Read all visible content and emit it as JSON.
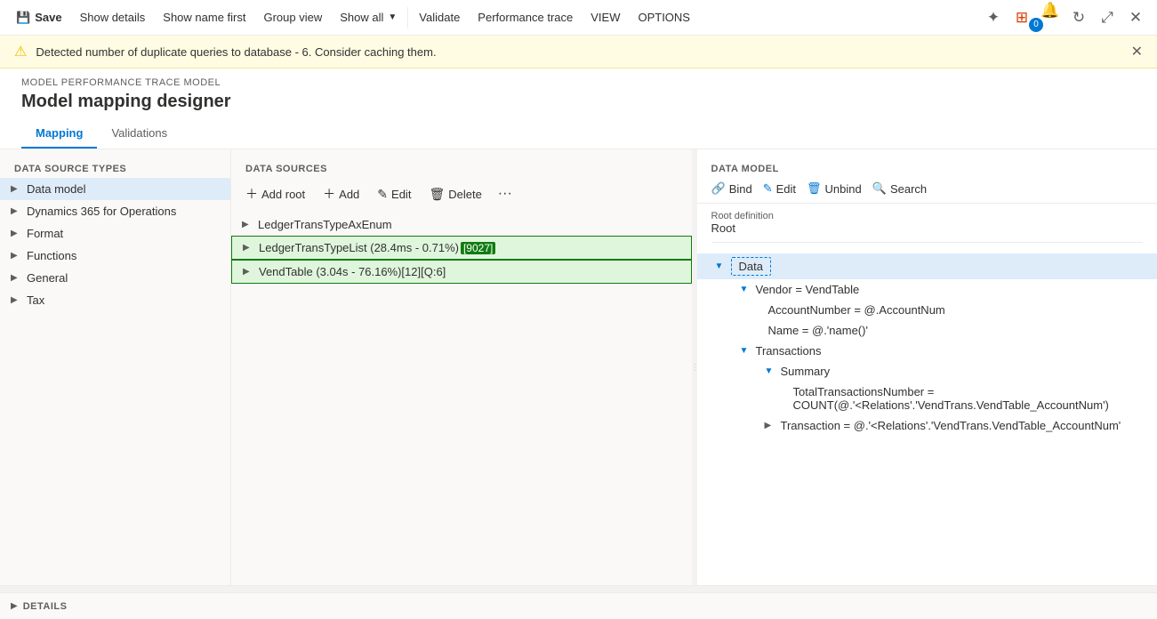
{
  "toolbar": {
    "save_label": "Save",
    "show_details_label": "Show details",
    "show_name_first_label": "Show name first",
    "group_view_label": "Group view",
    "show_all_label": "Show all",
    "validate_label": "Validate",
    "performance_trace_label": "Performance trace",
    "view_label": "VIEW",
    "options_label": "OPTIONS"
  },
  "warning": {
    "message": "Detected number of duplicate queries to database - 6. Consider caching them."
  },
  "breadcrumb": "MODEL PERFORMANCE TRACE MODEL",
  "page_title": "Model mapping designer",
  "tabs": [
    {
      "label": "Mapping",
      "active": true
    },
    {
      "label": "Validations",
      "active": false
    }
  ],
  "left_panel": {
    "data_source_types_header": "DATA SOURCE TYPES",
    "types": [
      {
        "label": "Data model",
        "selected": true
      },
      {
        "label": "Dynamics 365 for Operations"
      },
      {
        "label": "Format"
      },
      {
        "label": "Functions"
      },
      {
        "label": "General"
      },
      {
        "label": "Tax"
      }
    ]
  },
  "data_sources": {
    "header": "DATA SOURCES",
    "add_root_label": "Add root",
    "add_label": "Add",
    "edit_label": "Edit",
    "delete_label": "Delete",
    "items": [
      {
        "label": "LedgerTransTypeAxEnum",
        "highlighted": false
      },
      {
        "label": "LedgerTransTypeList (28.4ms - 0.71%)",
        "badge": "[9027]",
        "highlighted": true
      },
      {
        "label": "VendTable (3.04s - 76.16%)[12][Q:6]",
        "highlighted": true,
        "selected": true
      }
    ]
  },
  "data_model": {
    "header": "DATA MODEL",
    "bind_label": "Bind",
    "edit_label": "Edit",
    "unbind_label": "Unbind",
    "search_label": "Search",
    "root_definition_label": "Root definition",
    "root_value": "Root",
    "tree": [
      {
        "label": "Data",
        "level": 0,
        "expanded": true,
        "selected": true,
        "children": [
          {
            "label": "Vendor = VendTable",
            "level": 1,
            "expanded": true,
            "children": [
              {
                "label": "AccountNumber = @.AccountNum",
                "level": 2
              },
              {
                "label": "Name = @.'name()'",
                "level": 2
              }
            ]
          },
          {
            "label": "Transactions",
            "level": 1,
            "expanded": true,
            "children": [
              {
                "label": "Summary",
                "level": 2,
                "expanded": true,
                "children": [
                  {
                    "label": "TotalTransactionsNumber = COUNT(@.'<Relations'.'VendTrans.VendTable_AccountNum')",
                    "level": 3
                  }
                ]
              },
              {
                "label": "Transaction = @.'<Relations'.'VendTrans.VendTable_AccountNum'",
                "level": 2,
                "collapsed": true
              }
            ]
          }
        ]
      }
    ]
  },
  "details": {
    "label": "DETAILS"
  }
}
